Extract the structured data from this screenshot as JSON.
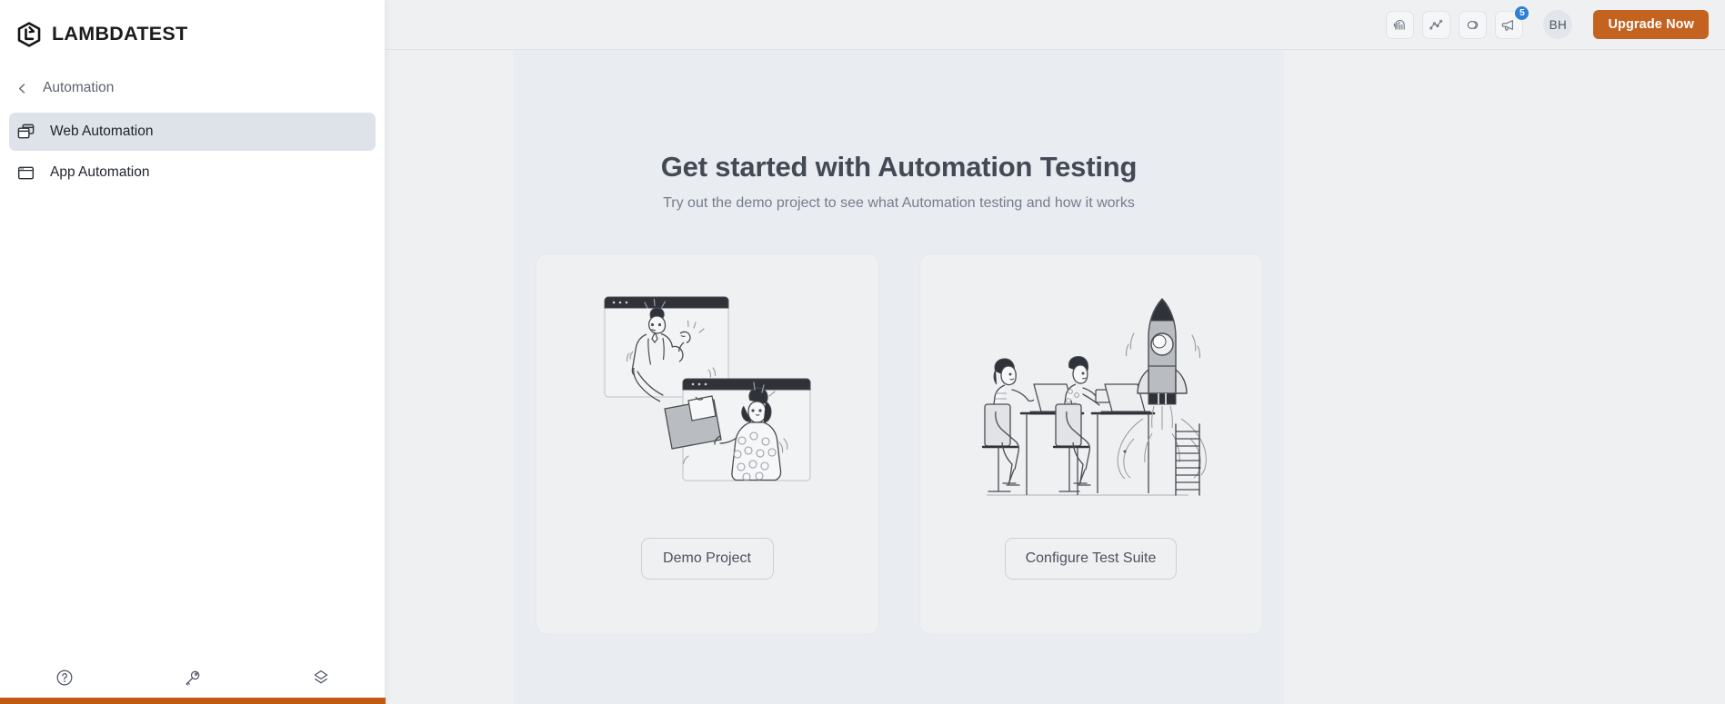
{
  "brand": {
    "name": "LAMBDATEST",
    "logo_icon": "lambdatest-logo-icon"
  },
  "sidebar": {
    "back": {
      "label": "Automation",
      "icon": "chevron-left-icon"
    },
    "items": [
      {
        "label": "Web Automation",
        "icon": "windows-stack-icon",
        "active": true
      },
      {
        "label": "App Automation",
        "icon": "app-window-icon",
        "active": false
      }
    ],
    "footer_icons": [
      {
        "name": "help-circle-icon"
      },
      {
        "name": "key-icon"
      },
      {
        "name": "layers-icon"
      }
    ],
    "accent_color": "#c05a14"
  },
  "header": {
    "icons": [
      {
        "name": "fingerprint-icon"
      },
      {
        "name": "analytics-icon"
      },
      {
        "name": "link-chain-icon"
      },
      {
        "name": "announcement-megaphone-icon",
        "badge": "5"
      }
    ],
    "notification_count": "5",
    "avatar_initials": "BH",
    "upgrade_label": "Upgrade Now",
    "upgrade_color": "#c4621f",
    "badge_color": "#2f7fd6"
  },
  "main": {
    "title": "Get started with Automation Testing",
    "subtitle": "Try out the demo project to see what Automation testing and how it works",
    "cards": [
      {
        "illustration": "two-people-browser-windows-handshake-illustration",
        "button_label": "Demo Project"
      },
      {
        "illustration": "team-desks-rocket-launch-illustration",
        "button_label": "Configure Test Suite"
      }
    ]
  }
}
